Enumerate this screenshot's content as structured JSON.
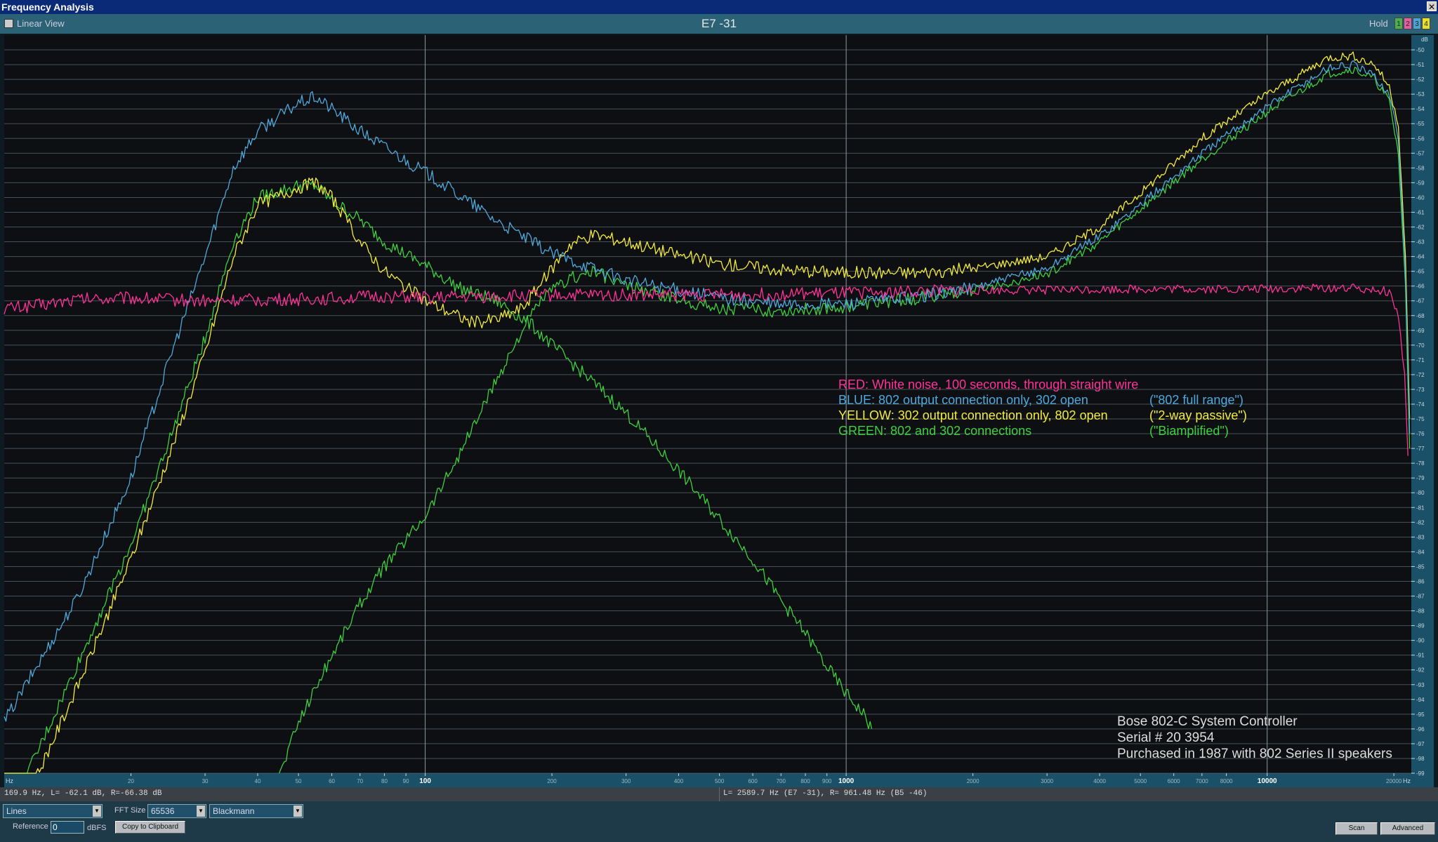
{
  "window": {
    "title": "Frequency Analysis",
    "close_label": "✕"
  },
  "header": {
    "linear_view_label": "Linear View",
    "channel_title": "E7 -31",
    "hold_label": "Hold",
    "hold_buttons": [
      {
        "label": "1",
        "color": "#4caf50"
      },
      {
        "label": "2",
        "color": "#e060a0"
      },
      {
        "label": "3",
        "color": "#4aa3d8"
      },
      {
        "label": "4",
        "color": "#e8e030"
      }
    ]
  },
  "chart_data": {
    "type": "line",
    "xscale": "log",
    "xlim": [
      10,
      22000
    ],
    "ylim": [
      -99,
      -49
    ],
    "x_unit_label": "Hz",
    "y_unit_label": "dB",
    "grid": true,
    "x_ticks": [
      {
        "v": 20,
        "l": "20"
      },
      {
        "v": 30,
        "l": "30"
      },
      {
        "v": 40,
        "l": "40"
      },
      {
        "v": 50,
        "l": "50"
      },
      {
        "v": 60,
        "l": "60"
      },
      {
        "v": 70,
        "l": "70"
      },
      {
        "v": 80,
        "l": "80"
      },
      {
        "v": 90,
        "l": "90"
      },
      {
        "v": 100,
        "l": "100"
      },
      {
        "v": 200,
        "l": "200"
      },
      {
        "v": 300,
        "l": "300"
      },
      {
        "v": 400,
        "l": "400"
      },
      {
        "v": 500,
        "l": "500"
      },
      {
        "v": 600,
        "l": "600"
      },
      {
        "v": 700,
        "l": "700"
      },
      {
        "v": 800,
        "l": "800"
      },
      {
        "v": 900,
        "l": "900"
      },
      {
        "v": 1000,
        "l": "1000"
      },
      {
        "v": 2000,
        "l": "2000"
      },
      {
        "v": 3000,
        "l": "3000"
      },
      {
        "v": 4000,
        "l": "4000"
      },
      {
        "v": 5000,
        "l": "5000"
      },
      {
        "v": 6000,
        "l": "6000"
      },
      {
        "v": 7000,
        "l": "7000"
      },
      {
        "v": 8000,
        "l": "8000"
      },
      {
        "v": 10000,
        "l": "10000"
      },
      {
        "v": 20000,
        "l": "20000"
      }
    ],
    "y_ticks": [
      -50,
      -51,
      -52,
      -53,
      -54,
      -55,
      -56,
      -57,
      -58,
      -59,
      -60,
      -61,
      -62,
      -63,
      -64,
      -65,
      -66,
      -67,
      -68,
      -69,
      -70,
      -71,
      -72,
      -73,
      -74,
      -75,
      -76,
      -77,
      -78,
      -79,
      -80,
      -81,
      -82,
      -83,
      -84,
      -85,
      -86,
      -87,
      -88,
      -89,
      -90,
      -91,
      -92,
      -93,
      -94,
      -95,
      -96,
      -97,
      -98,
      -99
    ],
    "series": [
      {
        "name": "RED",
        "color": "#ff3399",
        "points": [
          [
            10,
            -67.5
          ],
          [
            12,
            -67.3
          ],
          [
            15,
            -66.9
          ],
          [
            20,
            -66.8
          ],
          [
            30,
            -67
          ],
          [
            50,
            -66.9
          ],
          [
            80,
            -66.7
          ],
          [
            100,
            -66.8
          ],
          [
            200,
            -66.6
          ],
          [
            500,
            -66.6
          ],
          [
            1000,
            -66.5
          ],
          [
            2000,
            -66.3
          ],
          [
            5000,
            -66.2
          ],
          [
            10000,
            -66.2
          ],
          [
            15000,
            -66.1
          ],
          [
            18000,
            -66.2
          ],
          [
            19500,
            -66.4
          ],
          [
            20500,
            -68
          ],
          [
            21200,
            -72
          ],
          [
            21600,
            -77.5
          ]
        ]
      },
      {
        "name": "BLUE",
        "color": "#4fa9dc",
        "points": [
          [
            10,
            -95.5
          ],
          [
            15,
            -87
          ],
          [
            20,
            -79
          ],
          [
            25,
            -70.5
          ],
          [
            30,
            -64
          ],
          [
            35,
            -58
          ],
          [
            40,
            -55.5
          ],
          [
            50,
            -53.6
          ],
          [
            55,
            -53.2
          ],
          [
            60,
            -54
          ],
          [
            70,
            -55.5
          ],
          [
            90,
            -57.5
          ],
          [
            100,
            -58.3
          ],
          [
            150,
            -61.7
          ],
          [
            200,
            -63.8
          ],
          [
            300,
            -65.6
          ],
          [
            500,
            -66.8
          ],
          [
            700,
            -67.3
          ],
          [
            1000,
            -67.2
          ],
          [
            1500,
            -66.7
          ],
          [
            2000,
            -66.1
          ],
          [
            3000,
            -64.8
          ],
          [
            4000,
            -62.6
          ],
          [
            5000,
            -60.5
          ],
          [
            7000,
            -57
          ],
          [
            10000,
            -53.8
          ],
          [
            14000,
            -51.2
          ],
          [
            16000,
            -51
          ],
          [
            18000,
            -51.8
          ],
          [
            19500,
            -53
          ],
          [
            20500,
            -56
          ],
          [
            21300,
            -65
          ],
          [
            21800,
            -76
          ]
        ]
      },
      {
        "name": "YELLOW",
        "color": "#f4ec3a",
        "points": [
          [
            10,
            -104
          ],
          [
            15,
            -93
          ],
          [
            20,
            -84.5
          ],
          [
            25,
            -77
          ],
          [
            30,
            -70.5
          ],
          [
            35,
            -64
          ],
          [
            40,
            -60.5
          ],
          [
            50,
            -59.3
          ],
          [
            55,
            -59
          ],
          [
            60,
            -60
          ],
          [
            70,
            -63
          ],
          [
            80,
            -65
          ],
          [
            100,
            -67
          ],
          [
            130,
            -68.5
          ],
          [
            150,
            -68.2
          ],
          [
            170,
            -67.5
          ],
          [
            190,
            -65.7
          ],
          [
            220,
            -63.2
          ],
          [
            250,
            -62.5
          ],
          [
            300,
            -63
          ],
          [
            400,
            -63.9
          ],
          [
            500,
            -64.5
          ],
          [
            700,
            -64.9
          ],
          [
            1000,
            -65.1
          ],
          [
            1500,
            -65.1
          ],
          [
            2000,
            -64.8
          ],
          [
            3000,
            -64
          ],
          [
            4000,
            -62
          ],
          [
            5000,
            -59.7
          ],
          [
            7000,
            -56
          ],
          [
            10000,
            -53
          ],
          [
            14000,
            -50.5
          ],
          [
            16000,
            -50.4
          ],
          [
            18000,
            -51
          ],
          [
            19500,
            -52.5
          ],
          [
            20500,
            -55
          ],
          [
            21300,
            -64
          ],
          [
            21800,
            -75
          ]
        ]
      },
      {
        "name": "GREEN",
        "color": "#3fd03f",
        "points": [
          [
            10,
            -102.5
          ],
          [
            15,
            -91.5
          ],
          [
            20,
            -83.5
          ],
          [
            25,
            -76
          ],
          [
            30,
            -69.5
          ],
          [
            35,
            -63
          ],
          [
            40,
            -60
          ],
          [
            50,
            -59.2
          ],
          [
            55,
            -59.2
          ],
          [
            60,
            -60.2
          ],
          [
            70,
            -61.5
          ],
          [
            80,
            -63
          ],
          [
            100,
            -64.6
          ],
          [
            120,
            -66.1
          ],
          [
            150,
            -67.1
          ],
          [
            180,
            -68.7
          ],
          [
            200,
            -70
          ],
          [
            250,
            -72.5
          ],
          [
            300,
            -74.6
          ],
          [
            400,
            -78.5
          ],
          [
            500,
            -81.8
          ],
          [
            600,
            -84.5
          ],
          [
            700,
            -87.3
          ],
          [
            800,
            -89.5
          ],
          [
            900,
            -91.8
          ],
          [
            1000,
            -93.6
          ],
          [
            1100,
            -95
          ],
          [
            1150,
            -96
          ]
        ]
      },
      {
        "name": "GREEN",
        "color": "#3fd03f",
        "points": [
          [
            45,
            -99.2
          ],
          [
            50,
            -95.5
          ],
          [
            60,
            -91
          ],
          [
            70,
            -87.5
          ],
          [
            80,
            -85
          ],
          [
            100,
            -81.5
          ],
          [
            120,
            -77.5
          ],
          [
            150,
            -72
          ],
          [
            170,
            -69
          ],
          [
            190,
            -66.8
          ],
          [
            220,
            -65.5
          ],
          [
            250,
            -65
          ],
          [
            300,
            -66
          ],
          [
            400,
            -66.9
          ],
          [
            500,
            -67.5
          ],
          [
            700,
            -67.7
          ],
          [
            1000,
            -67.4
          ],
          [
            1500,
            -66.8
          ],
          [
            2000,
            -66.3
          ],
          [
            3000,
            -65.2
          ],
          [
            4000,
            -63
          ],
          [
            5000,
            -60.8
          ],
          [
            7000,
            -57.4
          ],
          [
            10000,
            -54.2
          ],
          [
            14000,
            -51.6
          ],
          [
            16000,
            -51.3
          ],
          [
            18000,
            -52
          ],
          [
            19500,
            -53.5
          ],
          [
            20500,
            -57
          ],
          [
            21300,
            -66
          ],
          [
            21800,
            -77
          ]
        ]
      }
    ],
    "annotations": {
      "legend_lines": [
        {
          "text": "RED:  White noise, 100 seconds, through straight wire",
          "color": "#ff3399"
        },
        {
          "text": "BLUE:  802 output connection only, 302 open",
          "color": "#4fa9dc"
        },
        {
          "text": "YELLOW:  302 output connection only, 802 open",
          "color": "#f4ec3a"
        },
        {
          "text": "GREEN:  802 and 302 connections",
          "color": "#3fd03f"
        }
      ],
      "legend_quotes": [
        {
          "text": "(\"802 full range\")",
          "color": "#4fa9dc"
        },
        {
          "text": "(\"2-way passive\")",
          "color": "#f4ec3a"
        },
        {
          "text": "(\"Biamplified\")",
          "color": "#3fd03f"
        }
      ],
      "footnote_lines": [
        "Bose 802-C System Controller",
        "Serial # 20 3954",
        "Purchased in 1987 with 802 Series II speakers"
      ]
    }
  },
  "status": {
    "left": "169.9 Hz, L= -62.1 dB, R=-66.38 dB",
    "right": "L= 2589.7 Hz (E7 -31), R= 961.48 Hz (B5 -46)"
  },
  "controls": {
    "display_mode": "Lines",
    "fft_size_label": "FFT Size",
    "fft_size": "65536",
    "window_fn": "Blackmann",
    "reference_label": "Reference",
    "reference_value": "0",
    "reference_unit": "dBFS",
    "copy_button": "Copy to Clipboard",
    "scan_button": "Scan",
    "advanced_button": "Advanced"
  }
}
